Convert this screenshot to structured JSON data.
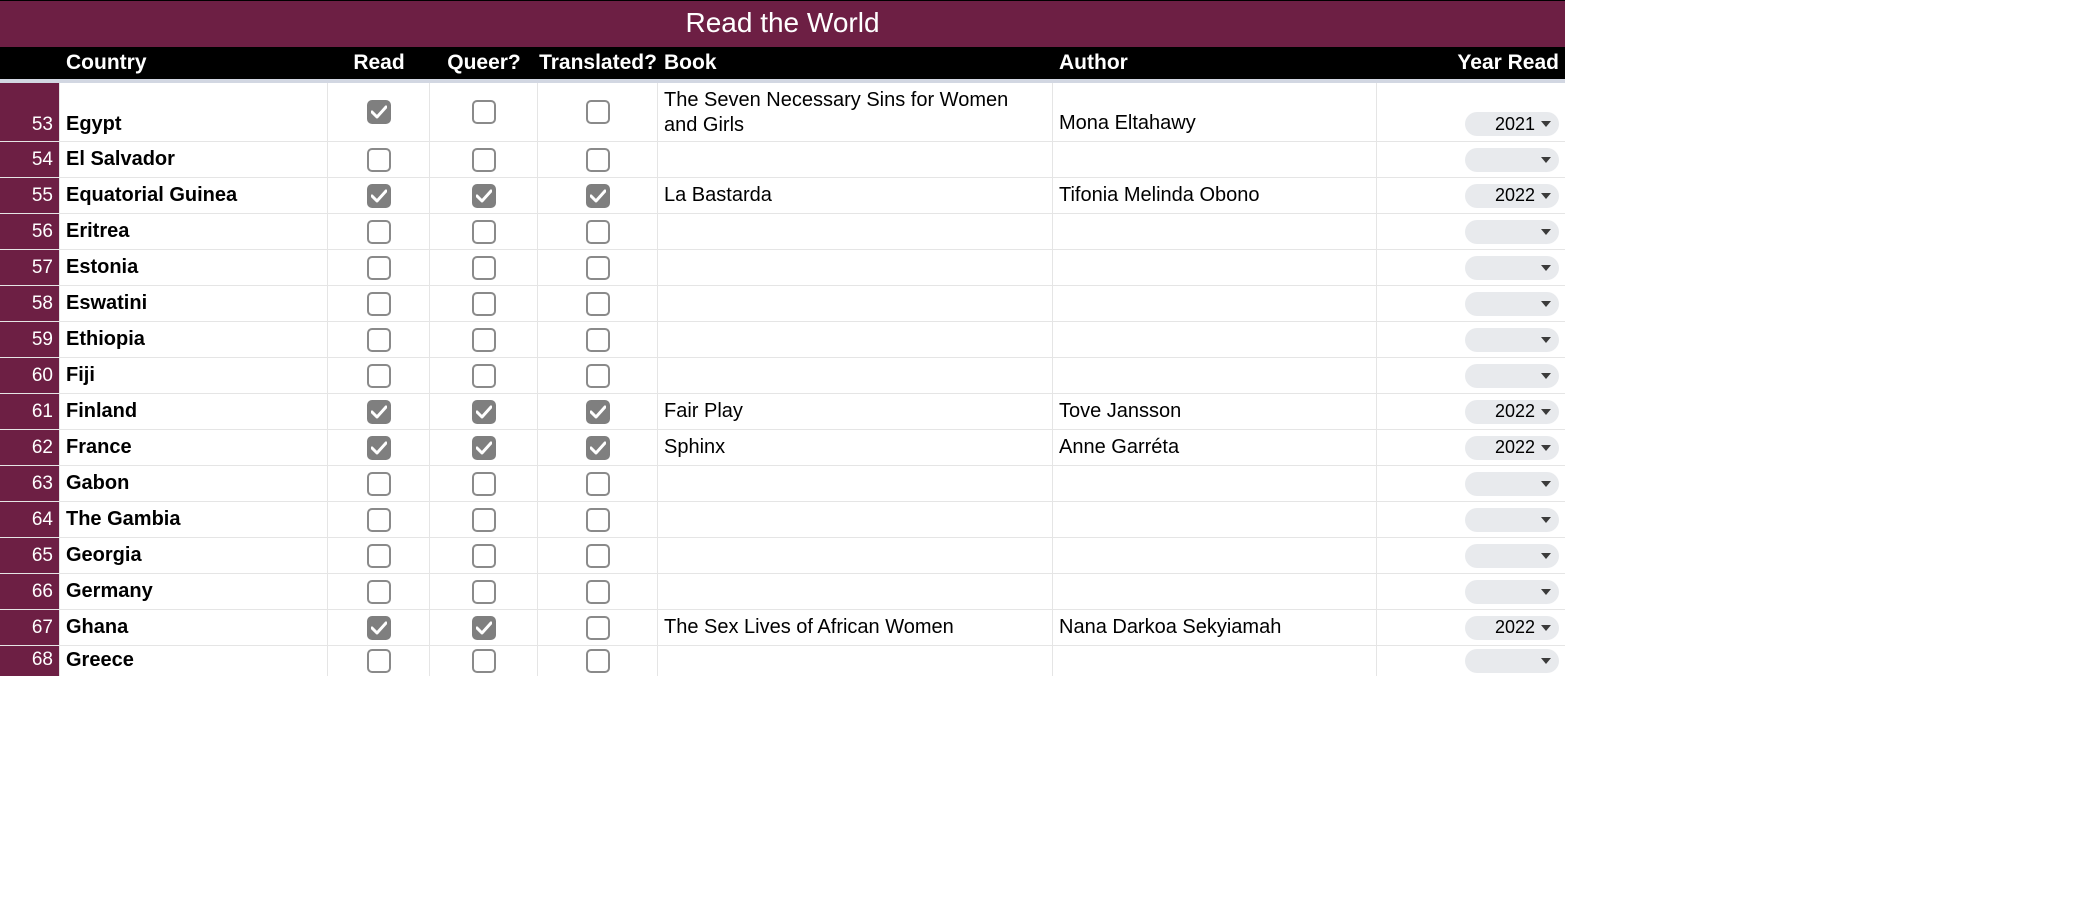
{
  "title": "Read the World",
  "headers": {
    "country": "Country",
    "read": "Read",
    "queer": "Queer?",
    "translated": "Translated?",
    "book": "Book",
    "author": "Author",
    "year": "Year Read"
  },
  "rows": [
    {
      "num": "53",
      "country": "Egypt",
      "read": true,
      "queer": false,
      "translated": false,
      "book": "The Seven Necessary Sins for Women and Girls",
      "author": "Mona Eltahawy",
      "year": "2021",
      "tall": true
    },
    {
      "num": "54",
      "country": "El Salvador",
      "read": false,
      "queer": false,
      "translated": false,
      "book": "",
      "author": "",
      "year": ""
    },
    {
      "num": "55",
      "country": "Equatorial Guinea",
      "read": true,
      "queer": true,
      "translated": true,
      "book": "La Bastarda",
      "author": "Tifonia Melinda Obono",
      "year": "2022"
    },
    {
      "num": "56",
      "country": "Eritrea",
      "read": false,
      "queer": false,
      "translated": false,
      "book": "",
      "author": "",
      "year": ""
    },
    {
      "num": "57",
      "country": "Estonia",
      "read": false,
      "queer": false,
      "translated": false,
      "book": "",
      "author": "",
      "year": ""
    },
    {
      "num": "58",
      "country": "Eswatini",
      "read": false,
      "queer": false,
      "translated": false,
      "book": "",
      "author": "",
      "year": ""
    },
    {
      "num": "59",
      "country": "Ethiopia",
      "read": false,
      "queer": false,
      "translated": false,
      "book": "",
      "author": "",
      "year": ""
    },
    {
      "num": "60",
      "country": "Fiji",
      "read": false,
      "queer": false,
      "translated": false,
      "book": "",
      "author": "",
      "year": ""
    },
    {
      "num": "61",
      "country": "Finland",
      "read": true,
      "queer": true,
      "translated": true,
      "book": "Fair Play",
      "author": "Tove Jansson",
      "year": "2022"
    },
    {
      "num": "62",
      "country": "France",
      "read": true,
      "queer": true,
      "translated": true,
      "book": "Sphinx",
      "author": "Anne Garréta",
      "year": "2022"
    },
    {
      "num": "63",
      "country": "Gabon",
      "read": false,
      "queer": false,
      "translated": false,
      "book": "",
      "author": "",
      "year": ""
    },
    {
      "num": "64",
      "country": "The Gambia",
      "read": false,
      "queer": false,
      "translated": false,
      "book": "",
      "author": "",
      "year": ""
    },
    {
      "num": "65",
      "country": "Georgia",
      "read": false,
      "queer": false,
      "translated": false,
      "book": "",
      "author": "",
      "year": ""
    },
    {
      "num": "66",
      "country": "Germany",
      "read": false,
      "queer": false,
      "translated": false,
      "book": "",
      "author": "",
      "year": ""
    },
    {
      "num": "67",
      "country": "Ghana",
      "read": true,
      "queer": true,
      "translated": false,
      "book": "The Sex Lives of African Women",
      "author": "Nana Darkoa Sekyiamah",
      "year": "2022"
    },
    {
      "num": "68",
      "country": "Greece",
      "read": false,
      "queer": false,
      "translated": false,
      "book": "",
      "author": "",
      "year": "",
      "last": true
    }
  ]
}
